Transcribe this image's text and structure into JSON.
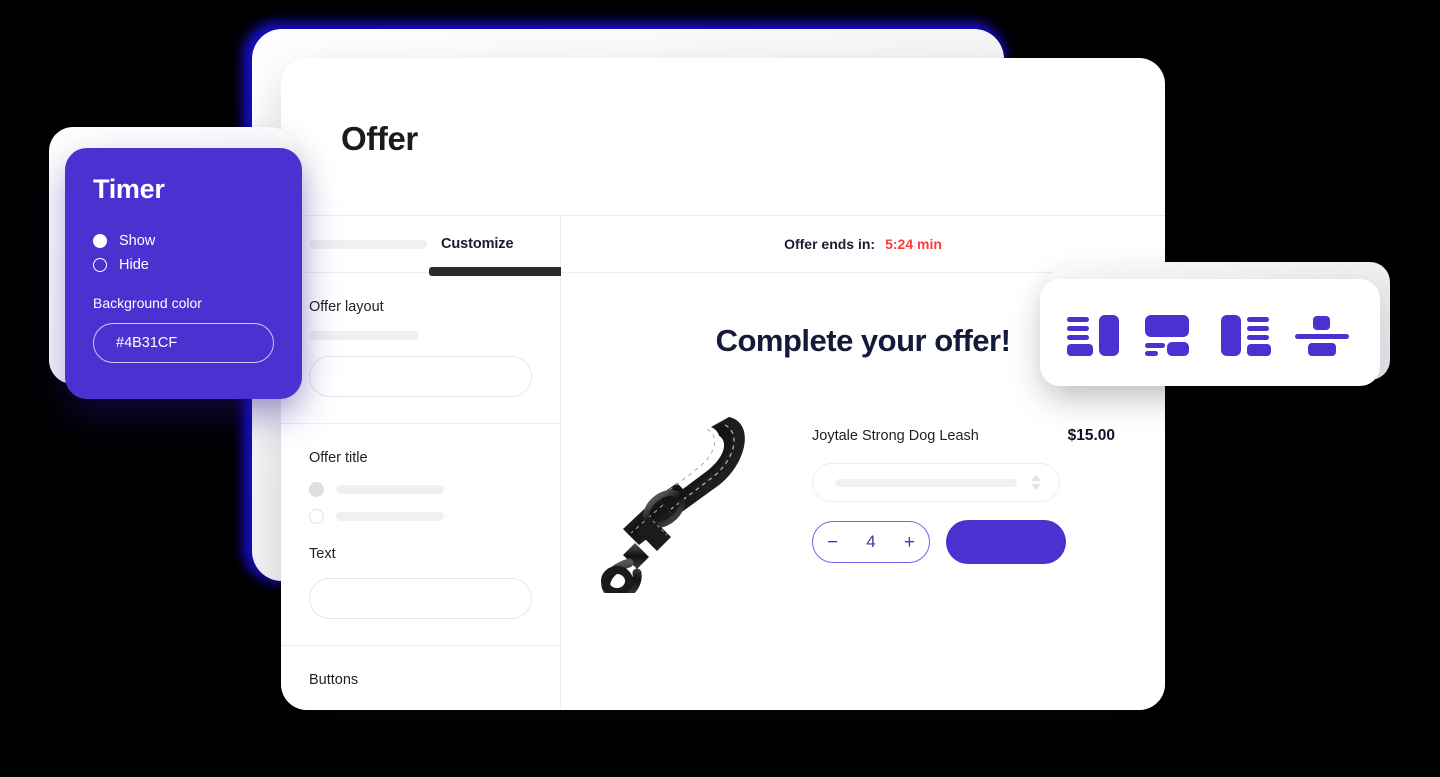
{
  "back_cards": {
    "glow_color": "#1a0fd6",
    "card_color": "#f2f2f4"
  },
  "offer_card": {
    "title": "Offer",
    "left_panel": {
      "tab_active": "Customize",
      "sections": [
        {
          "title": "Offer layout"
        },
        {
          "title": "Offer title"
        },
        {
          "title": "Text"
        },
        {
          "title": "Buttons"
        }
      ]
    },
    "preview": {
      "timer_label": "Offer ends in:",
      "timer_value": "5:24 min",
      "timer_value_color": "#fa3c3c",
      "heading": "Complete your offer!",
      "product": {
        "name": "Joytale Strong Dog Leash",
        "price": "$15.00",
        "image_alt": "black-dog-leash",
        "quantity": "4",
        "minus_label": "−",
        "plus_label": "+",
        "cta_color": "#4b31cf"
      }
    }
  },
  "timer_panel": {
    "title": "Timer",
    "options": [
      {
        "label": "Show",
        "selected": true
      },
      {
        "label": "Hide",
        "selected": false
      }
    ],
    "background_color_label": "Background color",
    "background_color_value": "#4B31CF"
  },
  "layout_picker": {
    "accent_color": "#4b31cf",
    "options": [
      {
        "name": "layout-text-left-image-right"
      },
      {
        "name": "layout-image-top-text-bottom"
      },
      {
        "name": "layout-image-left-text-right"
      },
      {
        "name": "layout-stacked-centered"
      }
    ]
  }
}
